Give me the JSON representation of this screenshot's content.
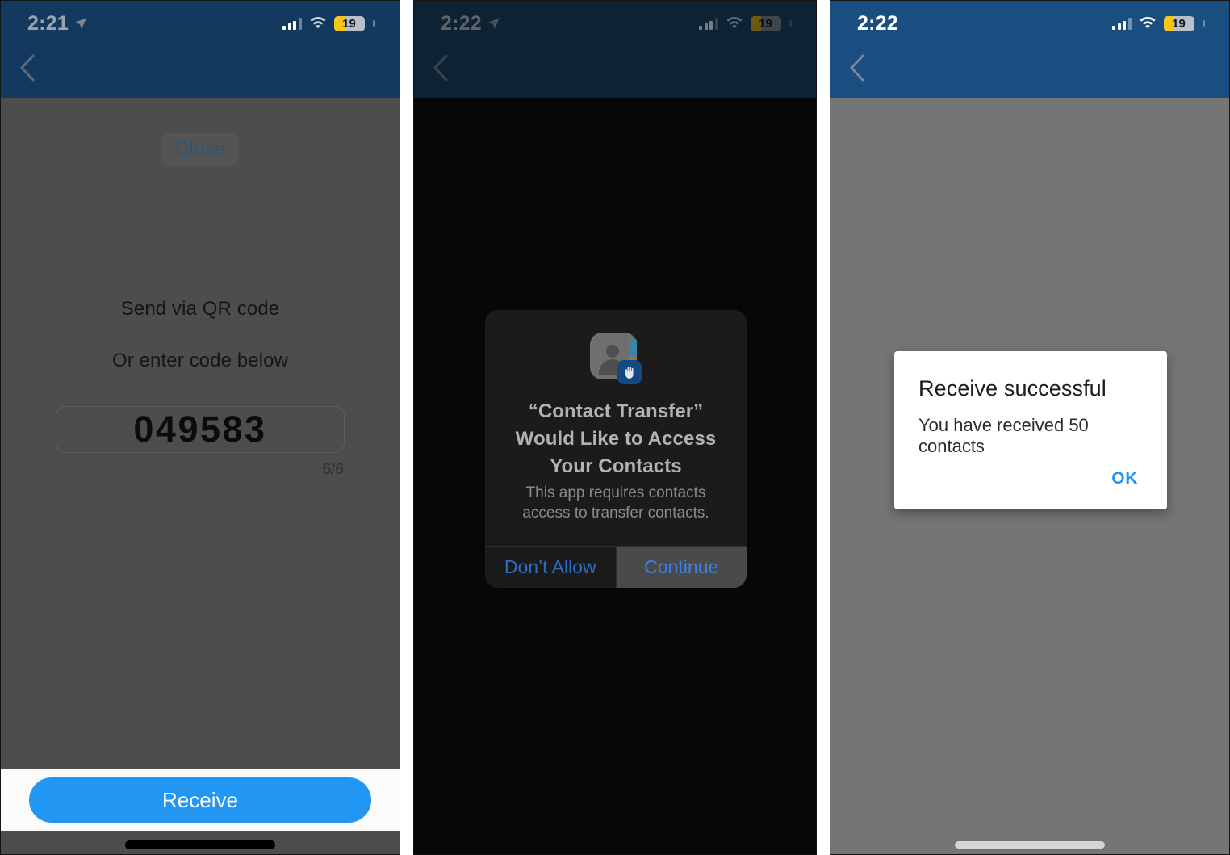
{
  "panels": [
    {
      "id": "code-entry",
      "status": {
        "time": "2:21",
        "battery": "19",
        "location_icon": "location-arrow-icon",
        "wifi_icon": "wifi-icon",
        "signal_icon": "cellular-bars-icon"
      },
      "navbar": {
        "back_icon": "back-chevron-icon",
        "color": "#133a5e"
      },
      "content": {
        "close_label": "Close",
        "qr_title": "Send via QR code",
        "qr_subtitle": "Or enter code below",
        "code_value": "049583",
        "code_counter": "6/6"
      },
      "footer": {
        "primary_label": "Receive",
        "primary_color": "#2196f3"
      }
    },
    {
      "id": "contacts-permission",
      "status": {
        "time": "2:22",
        "battery": "19",
        "location_icon": "location-arrow-icon",
        "wifi_icon": "wifi-icon",
        "signal_icon": "cellular-bars-icon"
      },
      "navbar": {
        "back_icon": "back-chevron-icon",
        "color": "#0d2233"
      },
      "dialog": {
        "icon": "contacts-privacy-icon",
        "title": "“Contact Transfer” Would Like to Access Your Contacts",
        "description": "This app requires contacts access to transfer contacts.",
        "deny_label": "Don’t Allow",
        "allow_label": "Continue",
        "accent_color": "#3d82e8"
      }
    },
    {
      "id": "receive-success",
      "status": {
        "time": "2:22",
        "battery": "19",
        "wifi_icon": "wifi-icon",
        "signal_icon": "cellular-bars-icon"
      },
      "navbar": {
        "back_icon": "back-chevron-icon",
        "color": "#1a4d80"
      },
      "alert": {
        "title": "Receive successful",
        "message": "You have received 50 contacts",
        "ok_label": "OK",
        "accent_color": "#2196f3"
      }
    }
  ]
}
